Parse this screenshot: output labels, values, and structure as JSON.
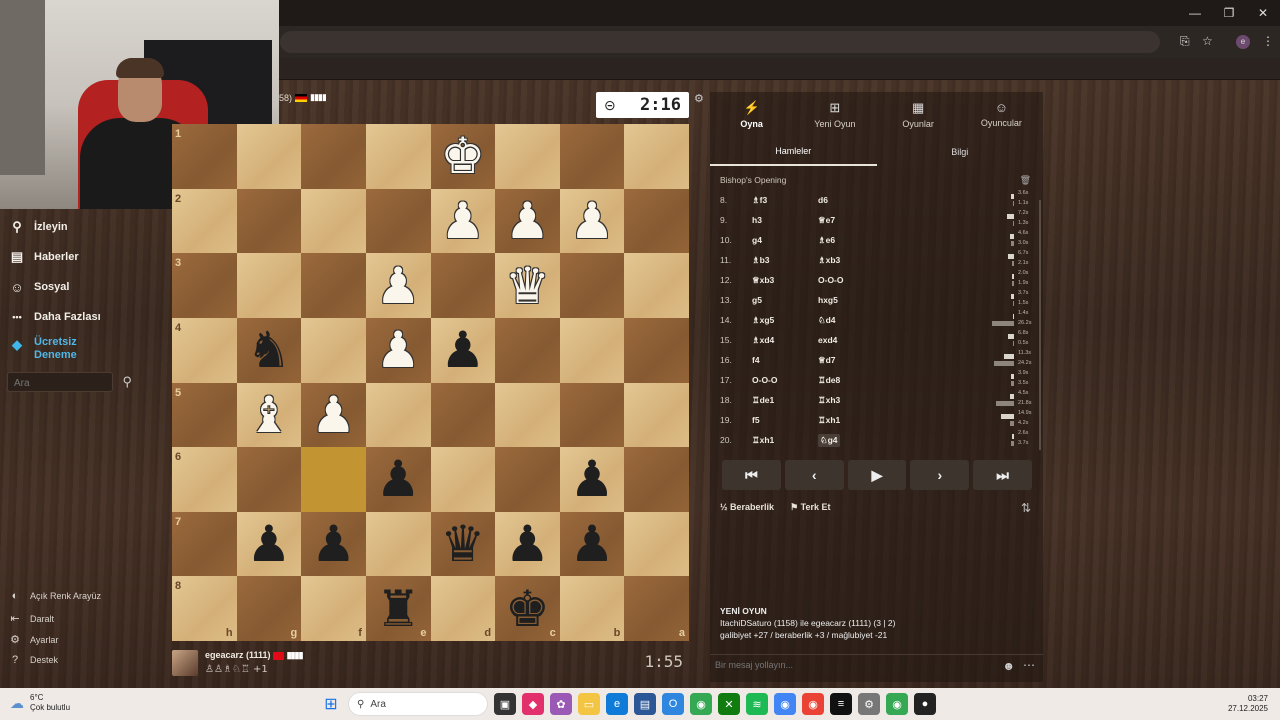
{
  "window": {
    "minimize": "—",
    "maximize": "❐",
    "close": "✕"
  },
  "browser": {
    "star_icon": "☆",
    "profile": "e",
    "menu": "⋮"
  },
  "sidenav": {
    "items": [
      {
        "label": "İzleyin",
        "icon": "binoculars-icon",
        "glyph": "⚲"
      },
      {
        "label": "Haberler",
        "icon": "news-icon",
        "glyph": "▤"
      },
      {
        "label": "Sosyal",
        "icon": "people-icon",
        "glyph": "☺"
      },
      {
        "label": "Daha Fazlası",
        "icon": "more-dots-icon",
        "glyph": "•••"
      }
    ],
    "trial_label": "Ücretsiz Deneme",
    "search_placeholder": "Ara",
    "bottom": [
      {
        "label": "Açık Renk Arayüz",
        "glyph": "◐"
      },
      {
        "label": "Daralt",
        "glyph": "⇤"
      },
      {
        "label": "Ayarlar",
        "glyph": "⚙"
      },
      {
        "label": "Destek",
        "glyph": "?"
      }
    ]
  },
  "top_player": {
    "rating": "58)",
    "signal": "▮▮▮▮"
  },
  "top_clock": "2:16",
  "bottom_player": {
    "name": "egeacarz (1111)",
    "signal": "▮▮▮▮",
    "captured": "♙♙♗♘♖ +1",
    "clock": "1:55"
  },
  "board": {
    "ranks": [
      "1",
      "2",
      "3",
      "4",
      "5",
      "6",
      "7",
      "8"
    ],
    "files": [
      "h",
      "g",
      "f",
      "e",
      "d",
      "c",
      "b",
      "a"
    ],
    "highlight": [
      [
        5,
        2
      ]
    ],
    "pieces": [
      [
        " ",
        " ",
        " ",
        " ",
        "K",
        " ",
        " ",
        " "
      ],
      [
        " ",
        " ",
        " ",
        " ",
        "P",
        "P",
        "P",
        " "
      ],
      [
        " ",
        " ",
        " ",
        "P",
        " ",
        "Q",
        " ",
        " "
      ],
      [
        " ",
        "n",
        " ",
        "P",
        "p",
        " ",
        " ",
        " "
      ],
      [
        " ",
        "B",
        "P",
        " ",
        " ",
        " ",
        " ",
        " "
      ],
      [
        " ",
        " ",
        " ",
        "p",
        " ",
        " ",
        "p",
        " "
      ],
      [
        " ",
        "p",
        "p",
        " ",
        "q",
        "p",
        "p",
        " "
      ],
      [
        " ",
        " ",
        " ",
        "r",
        " ",
        "k",
        " ",
        " "
      ]
    ]
  },
  "panel": {
    "topnav": [
      "Oyna",
      "Yeni Oyun",
      "Oyunlar",
      "Oyuncular"
    ],
    "tabs": [
      "Hamleler",
      "Bilgi"
    ],
    "opening": "Bishop's Opening",
    "moves": [
      {
        "no": "8.",
        "w": "♗f3",
        "b": "d6",
        "tw": "3.6s",
        "tb": "1.1s",
        "ww": 3,
        "wb": 1
      },
      {
        "no": "9.",
        "w": "h3",
        "b": "♕e7",
        "tw": "7.2s",
        "tb": "1.3s",
        "ww": 7,
        "wb": 1
      },
      {
        "no": "10.",
        "w": "g4",
        "b": "♗e6",
        "tw": "4.6s",
        "tb": "3.0s",
        "ww": 4,
        "wb": 3
      },
      {
        "no": "11.",
        "w": "♗b3",
        "b": "♗xb3",
        "tw": "6.7s",
        "tb": "2.1s",
        "ww": 6,
        "wb": 2
      },
      {
        "no": "12.",
        "w": "♕xb3",
        "b": "O-O-O",
        "tw": "2.0s",
        "tb": "1.9s",
        "ww": 2,
        "wb": 2
      },
      {
        "no": "13.",
        "w": "g5",
        "b": "hxg5",
        "tw": "3.7s",
        "tb": "1.5s",
        "ww": 3,
        "wb": 1
      },
      {
        "no": "14.",
        "w": "♗xg5",
        "b": "♘d4",
        "tw": "1.4s",
        "tb": "26.2s",
        "ww": 1,
        "wb": 22
      },
      {
        "no": "15.",
        "w": "♗xd4",
        "b": "exd4",
        "tw": "6.8s",
        "tb": "0.5s",
        "ww": 6,
        "wb": 1
      },
      {
        "no": "16.",
        "w": "f4",
        "b": "♕d7",
        "tw": "11.3s",
        "tb": "24.2s",
        "ww": 10,
        "wb": 20
      },
      {
        "no": "17.",
        "w": "O-O-O",
        "b": "♖de8",
        "tw": "3.9s",
        "tb": "3.5s",
        "ww": 3,
        "wb": 3
      },
      {
        "no": "18.",
        "w": "♖de1",
        "b": "♖xh3",
        "tw": "4.5s",
        "tb": "21.8s",
        "ww": 4,
        "wb": 18
      },
      {
        "no": "19.",
        "w": "f5",
        "b": "♖xh1",
        "tw": "14.9s",
        "tb": "4.2s",
        "ww": 13,
        "wb": 4
      },
      {
        "no": "20.",
        "w": "♖xh1",
        "b": "♘g4",
        "tw": "2.6s",
        "tb": "3.7s",
        "ww": 2,
        "wb": 3
      }
    ],
    "controls": [
      "⏮",
      "‹",
      "▶",
      "›",
      "⏭"
    ],
    "draw_label": "Beraberlik",
    "draw_prefix": "½",
    "resign_label": "Terk Et",
    "new_game_title": "YENİ OYUN",
    "new_game_line1": "ItachiDSaturo (1158) ile egeacarz (1111) (3 | 2)",
    "new_game_line2": "galibiyet +27 / beraberlik +3 / mağlubiyet -21",
    "chat_placeholder": "Bir mesaj yollayın..."
  },
  "taskbar": {
    "temp": "6°C",
    "weather": "Çok bulutlu",
    "search": "Ara",
    "time": "03:27",
    "date": "27.12.2025"
  }
}
